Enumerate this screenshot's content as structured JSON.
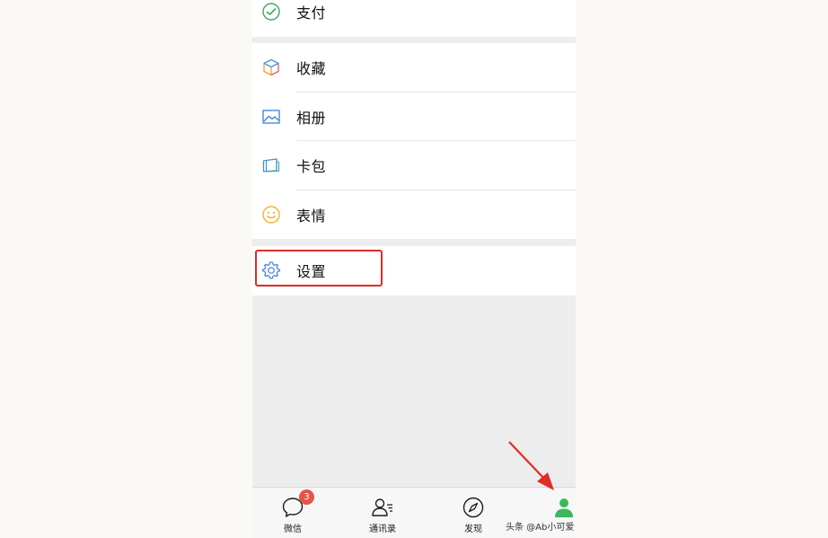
{
  "menu": {
    "pay_label": "支付",
    "favorites_label": "收藏",
    "album_label": "相册",
    "card_label": "卡包",
    "sticker_label": "表情",
    "settings_label": "设置"
  },
  "tabbar": {
    "chats_label": "微信",
    "chats_badge": "3",
    "contacts_label": "通讯录",
    "discover_label": "发现"
  },
  "watermark": "头条 @Ab小可爱",
  "colors": {
    "accent_green": "#07c160",
    "highlight_red": "#e02b27",
    "badge_red": "#e5534b"
  }
}
